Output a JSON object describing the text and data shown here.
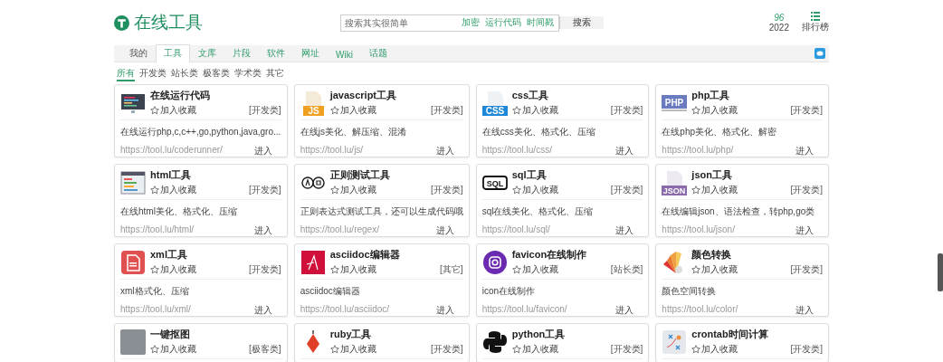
{
  "header": {
    "logo_text": "在线工具",
    "search": {
      "placeholder": "搜索其实很简单",
      "links": [
        "加密",
        "运行代码",
        "时间戳"
      ],
      "button": "搜索"
    },
    "stat": {
      "value": "96",
      "year": "2022"
    },
    "ranking": "排行榜"
  },
  "tabs": [
    {
      "label": "我的",
      "selected": false
    },
    {
      "label": "工具",
      "selected": true
    },
    {
      "label": "文库",
      "selected": false
    },
    {
      "label": "片段",
      "selected": false
    },
    {
      "label": "软件",
      "selected": false
    },
    {
      "label": "网址",
      "selected": false
    },
    {
      "label": "Wiki",
      "selected": false
    },
    {
      "label": "话题",
      "selected": false
    }
  ],
  "categories": [
    {
      "label": "所有",
      "selected": true
    },
    {
      "label": "开发类",
      "selected": false
    },
    {
      "label": "站长类",
      "selected": false
    },
    {
      "label": "极客类",
      "selected": false
    },
    {
      "label": "学术类",
      "selected": false
    },
    {
      "label": "其它",
      "selected": false
    }
  ],
  "cards": [
    {
      "title": "在线运行代码",
      "favorite": "加入收藏",
      "category": "[开发类]",
      "description": "在线运行php,c,c++,go,python,java,gro...",
      "url": "https://tool.lu/coderunner/",
      "enter": "进入"
    },
    {
      "title": "javascript工具",
      "icon_text": "JS",
      "favorite": "加入收藏",
      "category": "[开发类]",
      "description": "在线js美化、解压缩、混淆",
      "url": "https://tool.lu/js/",
      "enter": "进入"
    },
    {
      "title": "css工具",
      "icon_text": "CSS",
      "favorite": "加入收藏",
      "category": "[开发类]",
      "description": "在线css美化、格式化、压缩",
      "url": "https://tool.lu/css/",
      "enter": "进入"
    },
    {
      "title": "php工具",
      "icon_text": "PHP",
      "favorite": "加入收藏",
      "category": "[开发类]",
      "description": "在线php美化、格式化、解密",
      "url": "https://tool.lu/php/",
      "enter": "进入"
    },
    {
      "title": "html工具",
      "favorite": "加入收藏",
      "category": "[开发类]",
      "description": "在线html美化、格式化、压缩",
      "url": "https://tool.lu/html/",
      "enter": "进入"
    },
    {
      "title": "正则测试工具",
      "favorite": "加入收藏",
      "category": "[开发类]",
      "description": "正则表达式测试工具，还可以生成代码哦",
      "url": "https://tool.lu/regex/",
      "enter": "进入"
    },
    {
      "title": "sql工具",
      "icon_text": "SQL",
      "favorite": "加入收藏",
      "category": "[开发类]",
      "description": "sql在线美化、格式化、压缩",
      "url": "https://tool.lu/sql/",
      "enter": "进入"
    },
    {
      "title": "json工具",
      "icon_text": "JSON",
      "favorite": "加入收藏",
      "category": "[开发类]",
      "description": "在线编辑json、语法检查，转php,go类",
      "url": "https://tool.lu/json/",
      "enter": "进入"
    },
    {
      "title": "xml工具",
      "favorite": "加入收藏",
      "category": "[开发类]",
      "description": "xml格式化、压缩",
      "url": "https://tool.lu/xml/",
      "enter": "进入"
    },
    {
      "title": "asciidoc编辑器",
      "favorite": "加入收藏",
      "category": "[其它]",
      "description": "asciidoc编辑器",
      "url": "https://tool.lu/asciidoc/",
      "enter": "进入"
    },
    {
      "title": "favicon在线制作",
      "favorite": "加入收藏",
      "category": "[站长类]",
      "description": "icon在线制作",
      "url": "https://tool.lu/favicon/",
      "enter": "进入"
    },
    {
      "title": "颜色转换",
      "favorite": "加入收藏",
      "category": "[开发类]",
      "description": "颜色空间转换",
      "url": "https://tool.lu/color/",
      "enter": "进入"
    },
    {
      "title": "一键抠图",
      "favorite": "加入收藏",
      "category": "[极客类]"
    },
    {
      "title": "ruby工具",
      "favorite": "加入收藏",
      "category": "[开发类]"
    },
    {
      "title": "python工具",
      "favorite": "加入收藏",
      "category": "[开发类]"
    },
    {
      "title": "crontab时间计算",
      "favorite": "加入收藏",
      "category": "[开发类]"
    }
  ]
}
